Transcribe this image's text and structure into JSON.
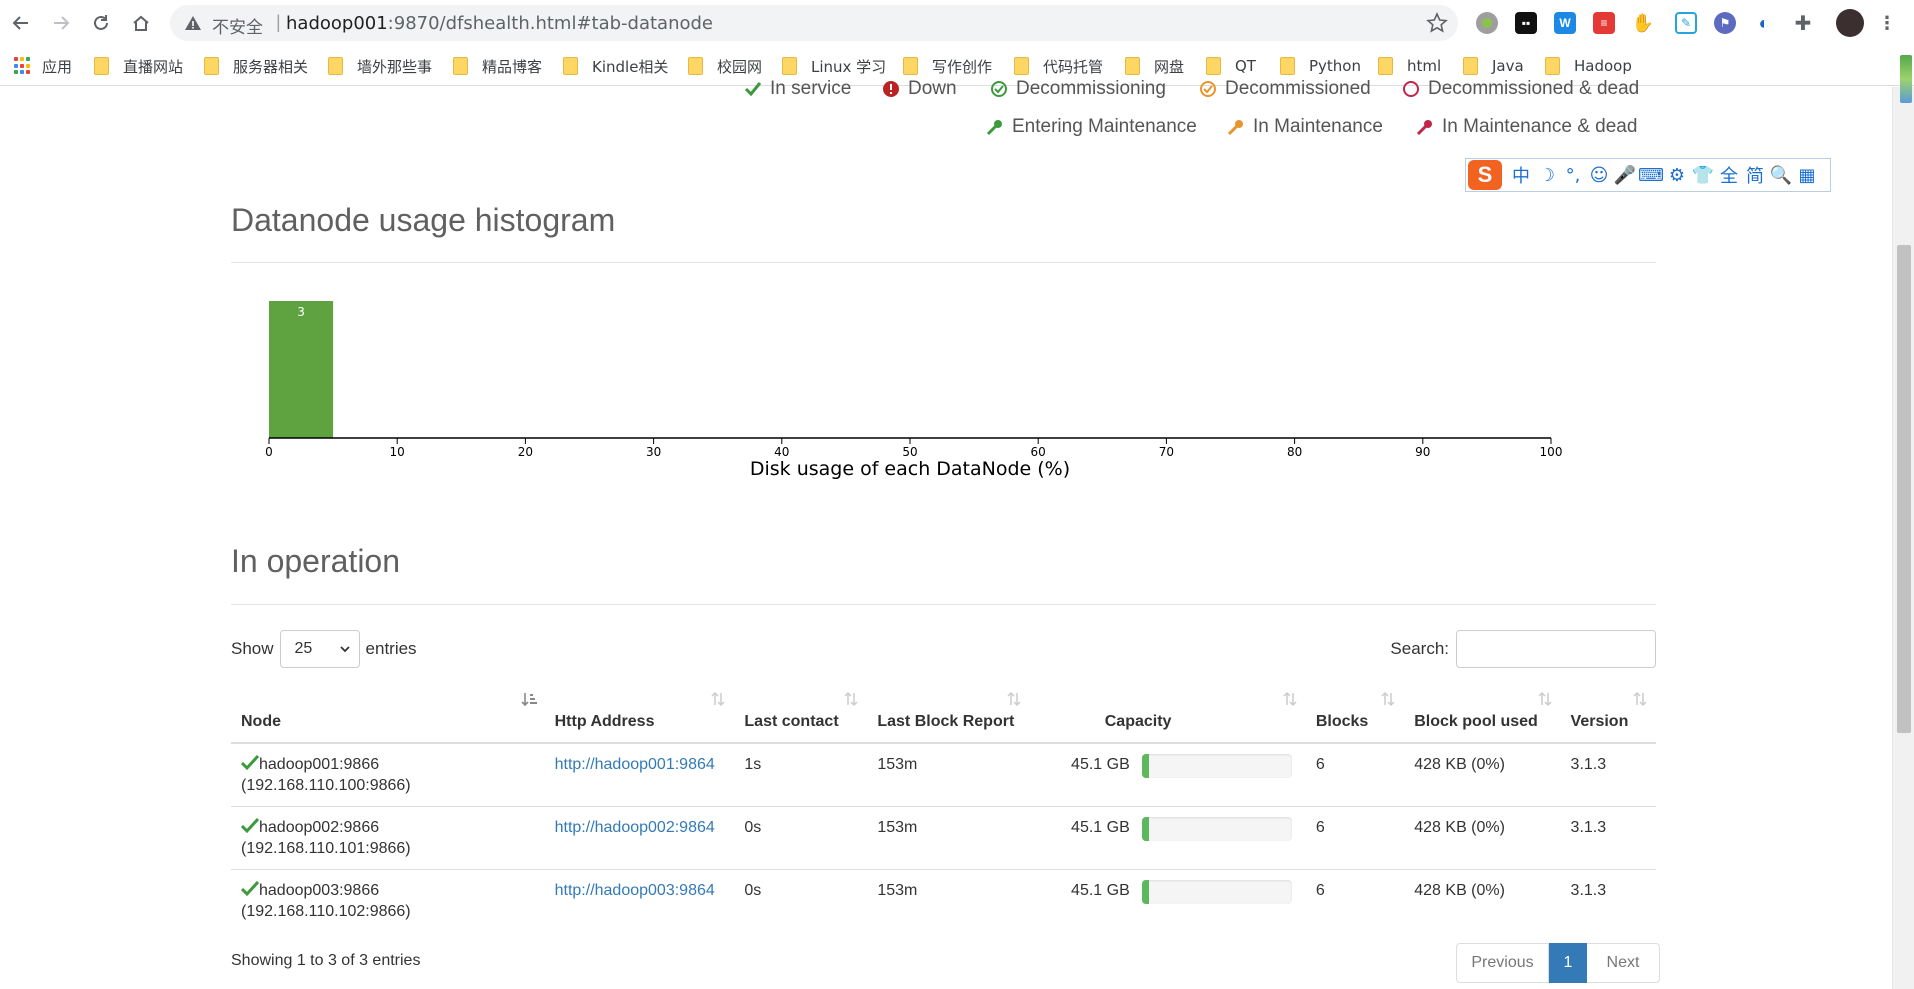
{
  "browser": {
    "insecure_label": "不安全",
    "separator": "|",
    "url_host": "hadoop001",
    "url_rest": ":9870/dfshealth.html#tab-datanode",
    "bookmarks": [
      "应用",
      "直播网站",
      "服务器相关",
      "墙外那些事",
      "精品博客",
      "Kindle相关",
      "校园网",
      "Linux 学习",
      "写作创作",
      "代码托管",
      "网盘",
      "QT",
      "Python",
      "html",
      "Java",
      "Hadoop"
    ]
  },
  "legend": {
    "row1": [
      "In service",
      "Down",
      "Decommissioning",
      "Decommissioned",
      "Decommissioned & dead"
    ],
    "row2": [
      "Entering Maintenance",
      "In Maintenance",
      "In Maintenance & dead"
    ]
  },
  "ime": {
    "logo": "S",
    "tools": [
      "中",
      "☽",
      "°,",
      "☺",
      "🎤",
      "⌨",
      "⚙",
      "👕",
      "全",
      "简",
      "🔍",
      "▦"
    ]
  },
  "histogram": {
    "title": "Datanode usage histogram",
    "xlabel": "Disk usage of each DataNode (%)"
  },
  "chart_data": {
    "type": "bar",
    "title": "Datanode usage histogram",
    "xlabel": "Disk usage of each DataNode (%)",
    "ylabel": "",
    "bins": [
      [
        0,
        5
      ]
    ],
    "values": [
      3
    ],
    "xlim": [
      0,
      100
    ],
    "xticks": [
      0,
      10,
      20,
      30,
      40,
      50,
      60,
      70,
      80,
      90,
      100
    ],
    "bar_color": "#5fa341"
  },
  "operation": {
    "title": "In operation",
    "show_label": "Show",
    "entries_value": "25",
    "entries_label": "entries",
    "search_label": "Search:",
    "columns": [
      "Node",
      "Http Address",
      "Last contact",
      "Last Block Report",
      "Capacity",
      "Blocks",
      "Block pool used",
      "Version"
    ],
    "rows": [
      {
        "node": "hadoop001:9866",
        "ip": "(192.168.110.100:9866)",
        "http": "http://hadoop001:9864",
        "last_contact": "1s",
        "last_block_report": "153m",
        "capacity": "45.1 GB",
        "used_fraction": 0.05,
        "blocks": "6",
        "block_pool_used": "428 KB (0%)",
        "version": "3.1.3"
      },
      {
        "node": "hadoop002:9866",
        "ip": "(192.168.110.101:9866)",
        "http": "http://hadoop002:9864",
        "last_contact": "0s",
        "last_block_report": "153m",
        "capacity": "45.1 GB",
        "used_fraction": 0.05,
        "blocks": "6",
        "block_pool_used": "428 KB (0%)",
        "version": "3.1.3"
      },
      {
        "node": "hadoop003:9866",
        "ip": "(192.168.110.102:9866)",
        "http": "http://hadoop003:9864",
        "last_contact": "0s",
        "last_block_report": "153m",
        "capacity": "45.1 GB",
        "used_fraction": 0.05,
        "blocks": "6",
        "block_pool_used": "428 KB (0%)",
        "version": "3.1.3"
      }
    ],
    "info": "Showing 1 to 3 of 3 entries",
    "pager": {
      "previous": "Previous",
      "current": "1",
      "next": "Next"
    }
  }
}
